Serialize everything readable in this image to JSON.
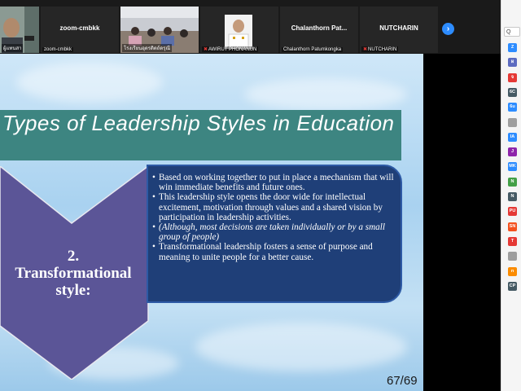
{
  "participants": [
    {
      "name": "",
      "label": "ผู้แทนสา",
      "muted": false
    },
    {
      "name": "zoom-cmbkk",
      "label": "zoom-cmbkk",
      "muted": false
    },
    {
      "name": "",
      "label": "โรงเรียนอุตรดิตถ์ดรุณี",
      "muted": false
    },
    {
      "name": "",
      "label": "AWIRUT PHONANUN",
      "muted": true
    },
    {
      "name": "Chalanthorn Pat...",
      "label": "Chalanthorn Patumkongka",
      "muted": false
    },
    {
      "name": "NUTCHARIN",
      "label": "NUTCHARIN",
      "muted": true
    }
  ],
  "next_button": "›",
  "right_panel": {
    "search_placeholder": "Q",
    "avatars": [
      {
        "initials": "Z",
        "color": "#2d8cff"
      },
      {
        "initials": "ผ",
        "color": "#5c6bc0"
      },
      {
        "initials": "จ",
        "color": "#e53935"
      },
      {
        "initials": "6C",
        "color": "#455a64"
      },
      {
        "initials": "6u",
        "color": "#2d8cff"
      },
      {
        "initials": "",
        "color": "#9e9e9e"
      },
      {
        "initials": "IA",
        "color": "#2d8cff"
      },
      {
        "initials": "J",
        "color": "#8e24aa"
      },
      {
        "initials": "MK",
        "color": "#2d8cff"
      },
      {
        "initials": "N",
        "color": "#43a047"
      },
      {
        "initials": "N",
        "color": "#455a64"
      },
      {
        "initials": "PU",
        "color": "#e53935"
      },
      {
        "initials": "SN",
        "color": "#f4511e"
      },
      {
        "initials": "T",
        "color": "#e53935"
      },
      {
        "initials": "",
        "color": "#9e9e9e"
      },
      {
        "initials": "n",
        "color": "#fb8c00"
      },
      {
        "initials": "CP",
        "color": "#455a64"
      }
    ]
  },
  "slide": {
    "title": "Types of Leadership Styles in Education",
    "style_number": "2.",
    "style_name": "Transformational style:",
    "bullets": [
      {
        "text": "Based on working together to put in  place a mechanism that will win  immediate benefits and future ones.",
        "italic": false
      },
      {
        "text": "This leadership style opens the door wide  for intellectual excitement, motivation  through values and a shared vision by  participation in leadership activities.",
        "italic": false
      },
      {
        "text": "(Although, most decisions are taken  individually or by a small group of people)",
        "italic": true
      },
      {
        "text": "Transformational leadership fosters a sense of purpose and meaning  to unite people for a better cause.",
        "italic": false
      }
    ],
    "page_number": "67/69",
    "colors": {
      "title_band": "#3d8581",
      "chevron": "#5b5597",
      "content_box": "#1f3f78"
    }
  }
}
